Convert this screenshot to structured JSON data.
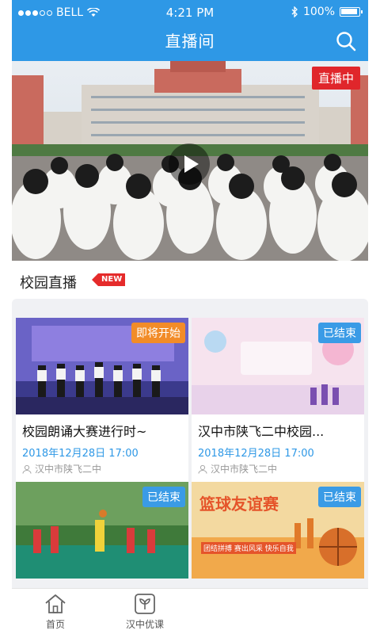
{
  "status_bar": {
    "carrier": "BELL",
    "time": "4:21 PM",
    "battery": "100%"
  },
  "header": {
    "title": "直播间",
    "search_icon": "search-icon"
  },
  "banner": {
    "badge": "直播中",
    "play_icon": "play-icon"
  },
  "section": {
    "title": "校园直播",
    "new_badge": "NEW"
  },
  "cards": [
    {
      "title": "校园朗诵大赛进行时~",
      "date": "2018年12月28日 17:00",
      "location": "汉中市陕飞二中",
      "status": "即将开始",
      "status_color": "#f28c28"
    },
    {
      "title": "汉中市陕飞二中校园...",
      "date": "2018年12月28日 17:00",
      "location": "汉中市陕飞二中",
      "status": "已结束",
      "status_color": "#3a9be6"
    },
    {
      "status": "已结束",
      "status_color": "#3a9be6"
    },
    {
      "status": "已结束",
      "status_color": "#3a9be6",
      "banner_text": "篮球友谊赛",
      "slogan": "团结拼搏  赛出风采  快乐自我"
    }
  ],
  "tabbar": {
    "home": "首页",
    "courses": "汉中优课"
  },
  "colors": {
    "primary": "#2e98e6",
    "live_red": "#e0262b"
  }
}
